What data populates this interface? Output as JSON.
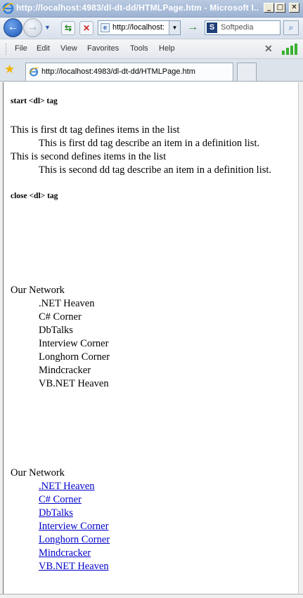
{
  "window": {
    "title": "http://localhost:4983/dl-dt-dd/HTMLPage.htm - Microsoft I...",
    "minimize": "_",
    "maximize": "□",
    "close": "✕"
  },
  "navbar": {
    "address": "http://localhost:",
    "search_provider": "Softpedia"
  },
  "menu": {
    "items": [
      "File",
      "Edit",
      "View",
      "Favorites",
      "Tools",
      "Help"
    ]
  },
  "tab": {
    "title": "http://localhost:4983/dl-dt-dd/HTMLPage.htm"
  },
  "content": {
    "start_label": "start <dl> tag",
    "dl": [
      {
        "dt": "This is first dt tag defines items in the list",
        "dd": "This is first dd tag describe an item in a definition list."
      },
      {
        "dt": "This is second defines items in the list",
        "dd": "This is second dd tag describe an item in a definition list."
      }
    ],
    "close_label": "close <dl> tag",
    "network_title": "Our Network",
    "network_items": [
      ".NET Heaven",
      "C# Corner",
      "DbTalks",
      "Interview Corner",
      "Longhorn Corner",
      "Mindcracker",
      "VB.NET Heaven"
    ],
    "network_links_title": "Our Network",
    "network_links": [
      ".NET Heaven",
      "C# Corner",
      "DbTalks",
      "Interview Corner",
      "Longhorn Corner",
      "Mindcracker",
      "VB.NET Heaven"
    ]
  }
}
